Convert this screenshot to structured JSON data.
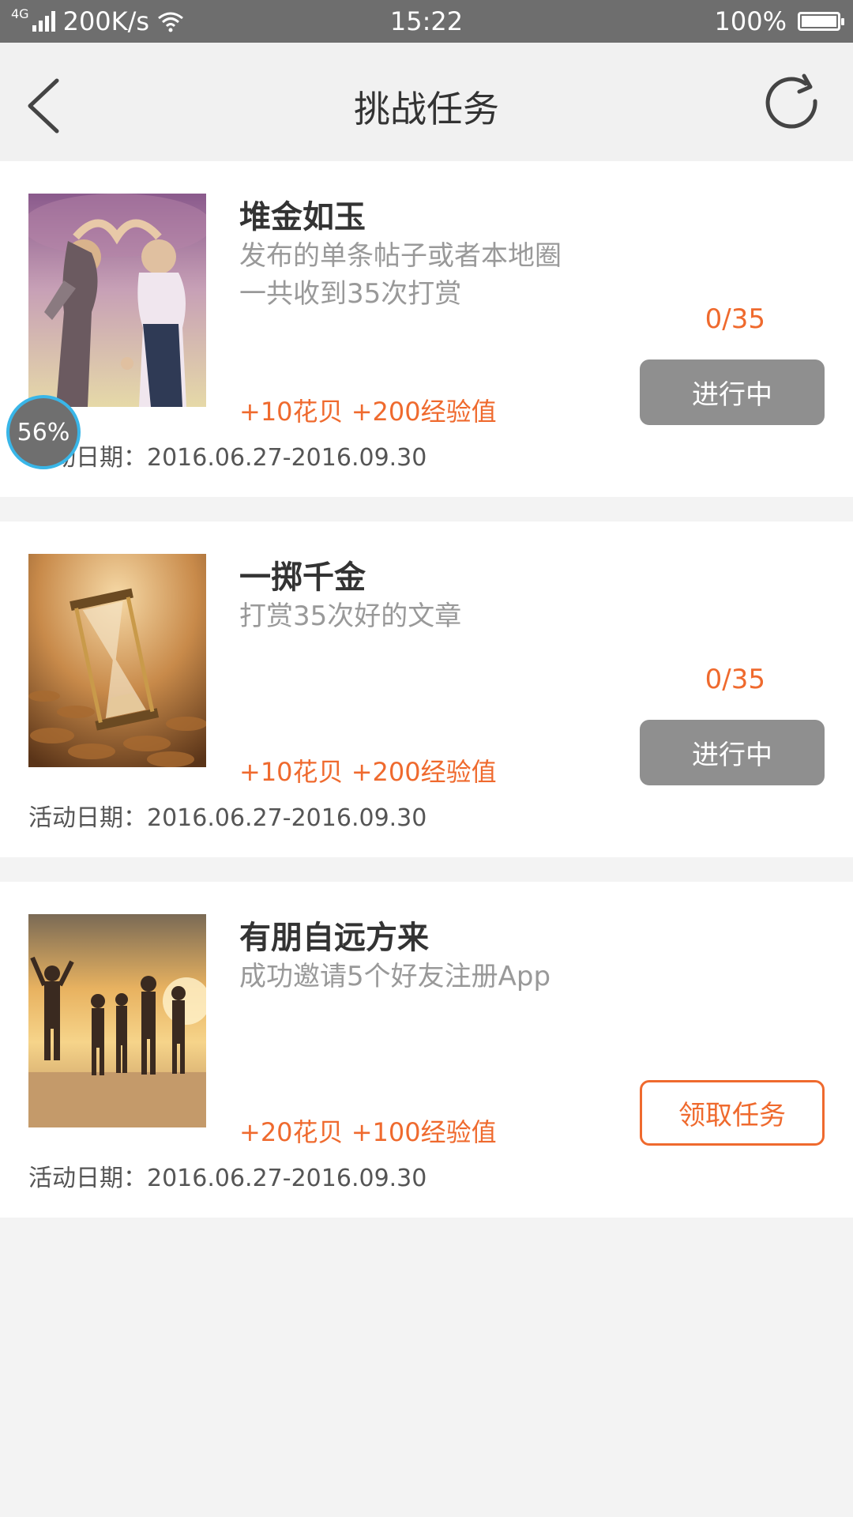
{
  "status_bar": {
    "network": "4G",
    "speed": "200K/s",
    "time": "15:22",
    "battery": "100%"
  },
  "header": {
    "title": "挑战任务",
    "back_icon": "chevron-left-icon",
    "refresh_icon": "refresh-icon"
  },
  "tasks": [
    {
      "title": "堆金如玉",
      "description": "发布的单条帖子或者本地圈一共收到35次打赏",
      "reward": "+10花贝 +200经验值",
      "date": "活动日期：2016.06.27-2016.09.30",
      "progress": "0/35",
      "button": "进行中",
      "image": "heart-hands-photo"
    },
    {
      "title": "一掷千金",
      "description": "打赏35次好的文章",
      "reward": "+10花贝 +200经验值",
      "date": "活动日期：2016.06.27-2016.09.30",
      "progress": "0/35",
      "button": "进行中",
      "image": "hourglass-coins-photo"
    },
    {
      "title": "有朋自远方来",
      "description": "成功邀请5个好友注册App",
      "reward": "+20花贝 +100经验值",
      "date": "活动日期：2016.06.27-2016.09.30",
      "progress": "",
      "button": "领取任务",
      "image": "beach-friends-photo"
    }
  ],
  "floating_badge": {
    "value": "56%"
  },
  "colors": {
    "accent": "#ef6a2e",
    "status_bar": "#6e6e6e",
    "nav_bg": "#f1f1f1",
    "button_grey": "#8f8f8f",
    "badge_ring": "#39b6e8"
  }
}
